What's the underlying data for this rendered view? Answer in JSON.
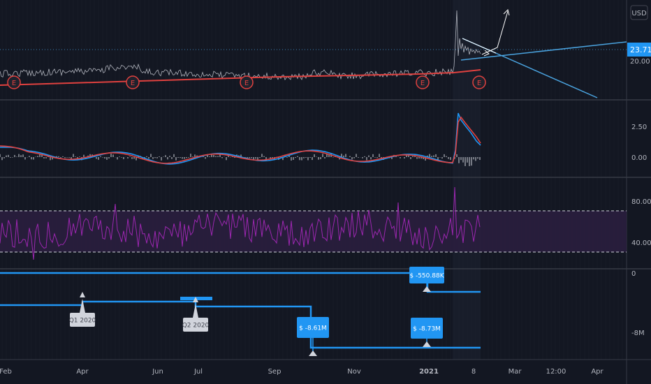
{
  "chart_data": {
    "type": "line",
    "currency_label": "USD",
    "price_label": "23.71",
    "x_ticks": [
      "Feb",
      "Apr",
      "Jun",
      "Jul",
      "Sep",
      "Nov",
      "2021",
      "8",
      "Mar",
      "12:00",
      "Apr"
    ],
    "earnings_marker": "E",
    "panes": [
      {
        "name": "price",
        "y_ticks": [
          "20.00"
        ]
      },
      {
        "name": "macd",
        "y_ticks": [
          "2.50",
          "0.00"
        ]
      },
      {
        "name": "rsi",
        "y_ticks": [
          "80.00",
          "40.00"
        ],
        "band": [
          30,
          70
        ]
      },
      {
        "name": "financials",
        "y_ticks": [
          "0",
          "-8M"
        ],
        "flags": [
          {
            "text": "Q1 2020",
            "style": "gray"
          },
          {
            "text": "Q2 2020",
            "style": "gray"
          },
          {
            "text": "$ -8.61M",
            "style": "blue"
          },
          {
            "text": "$ -8.73M",
            "style": "blue"
          },
          {
            "text": "$ -550.88K",
            "style": "blue"
          }
        ]
      }
    ],
    "colors": {
      "background": "#131722",
      "grid": "#2a2e39",
      "price_line": "#b2b5be",
      "ma_line": "#e0413f",
      "macd_line": "#2196f3",
      "signal_line": "#e0413f",
      "rsi_line": "#9c27b0",
      "rsi_band": "#2a1e3e",
      "financial_line": "#2196f3",
      "trendline": "#4aa3df"
    }
  }
}
